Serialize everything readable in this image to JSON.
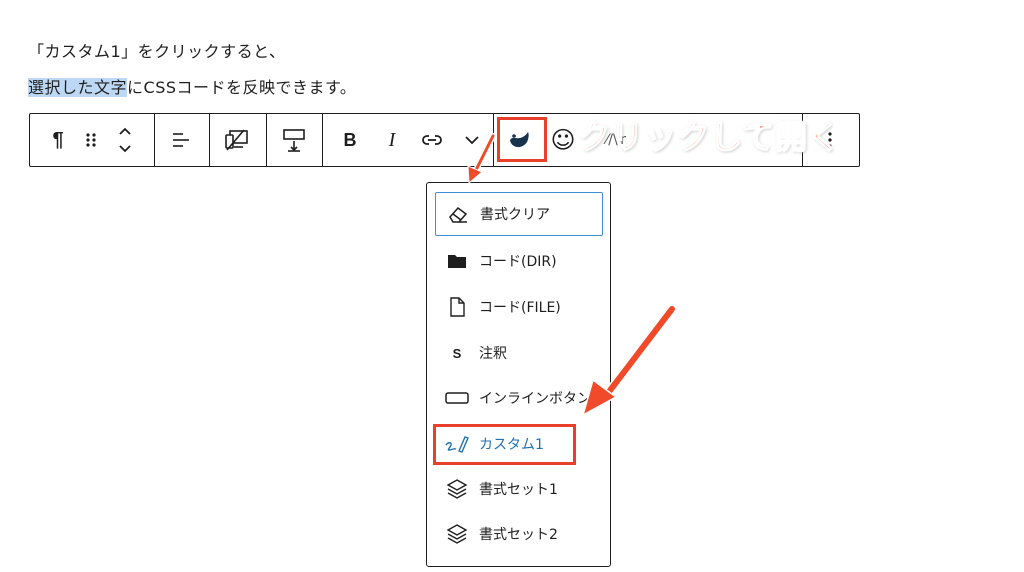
{
  "paragraph": {
    "line1": "「カスタム1」をクリックすると、",
    "line2_selected": "選択した文字",
    "line2_rest": "にCSSコードを反映できます。"
  },
  "toolbar": {
    "paragraph_glyph": "¶",
    "bold_label": "B",
    "italic_label": "I",
    "clipped_text": "⁄/\\ᴵr"
  },
  "callout": {
    "text": "クリックして開く",
    "color": "#ff4d2e"
  },
  "dropdown": {
    "items": [
      {
        "label": "書式クリア",
        "icon": "eraser-icon"
      },
      {
        "label": "コード(DIR)",
        "icon": "folder-icon"
      },
      {
        "label": "コード(FILE)",
        "icon": "file-icon"
      },
      {
        "label": "注釈",
        "icon": "letter-s-icon",
        "icon_text": "S"
      },
      {
        "label": "インラインボタン",
        "icon": "button-outline-icon"
      },
      {
        "label": "カスタム1",
        "icon": "pen-icon"
      },
      {
        "label": "書式セット1",
        "icon": "layers-icon"
      },
      {
        "label": "書式セット2",
        "icon": "layers-icon"
      }
    ]
  },
  "colors": {
    "selection": "#bcd8f4",
    "highlight_box": "#e8402b",
    "arrow": "#f04a2a",
    "accent_blue": "#2271b1",
    "focus_border": "#3f8fd6"
  }
}
